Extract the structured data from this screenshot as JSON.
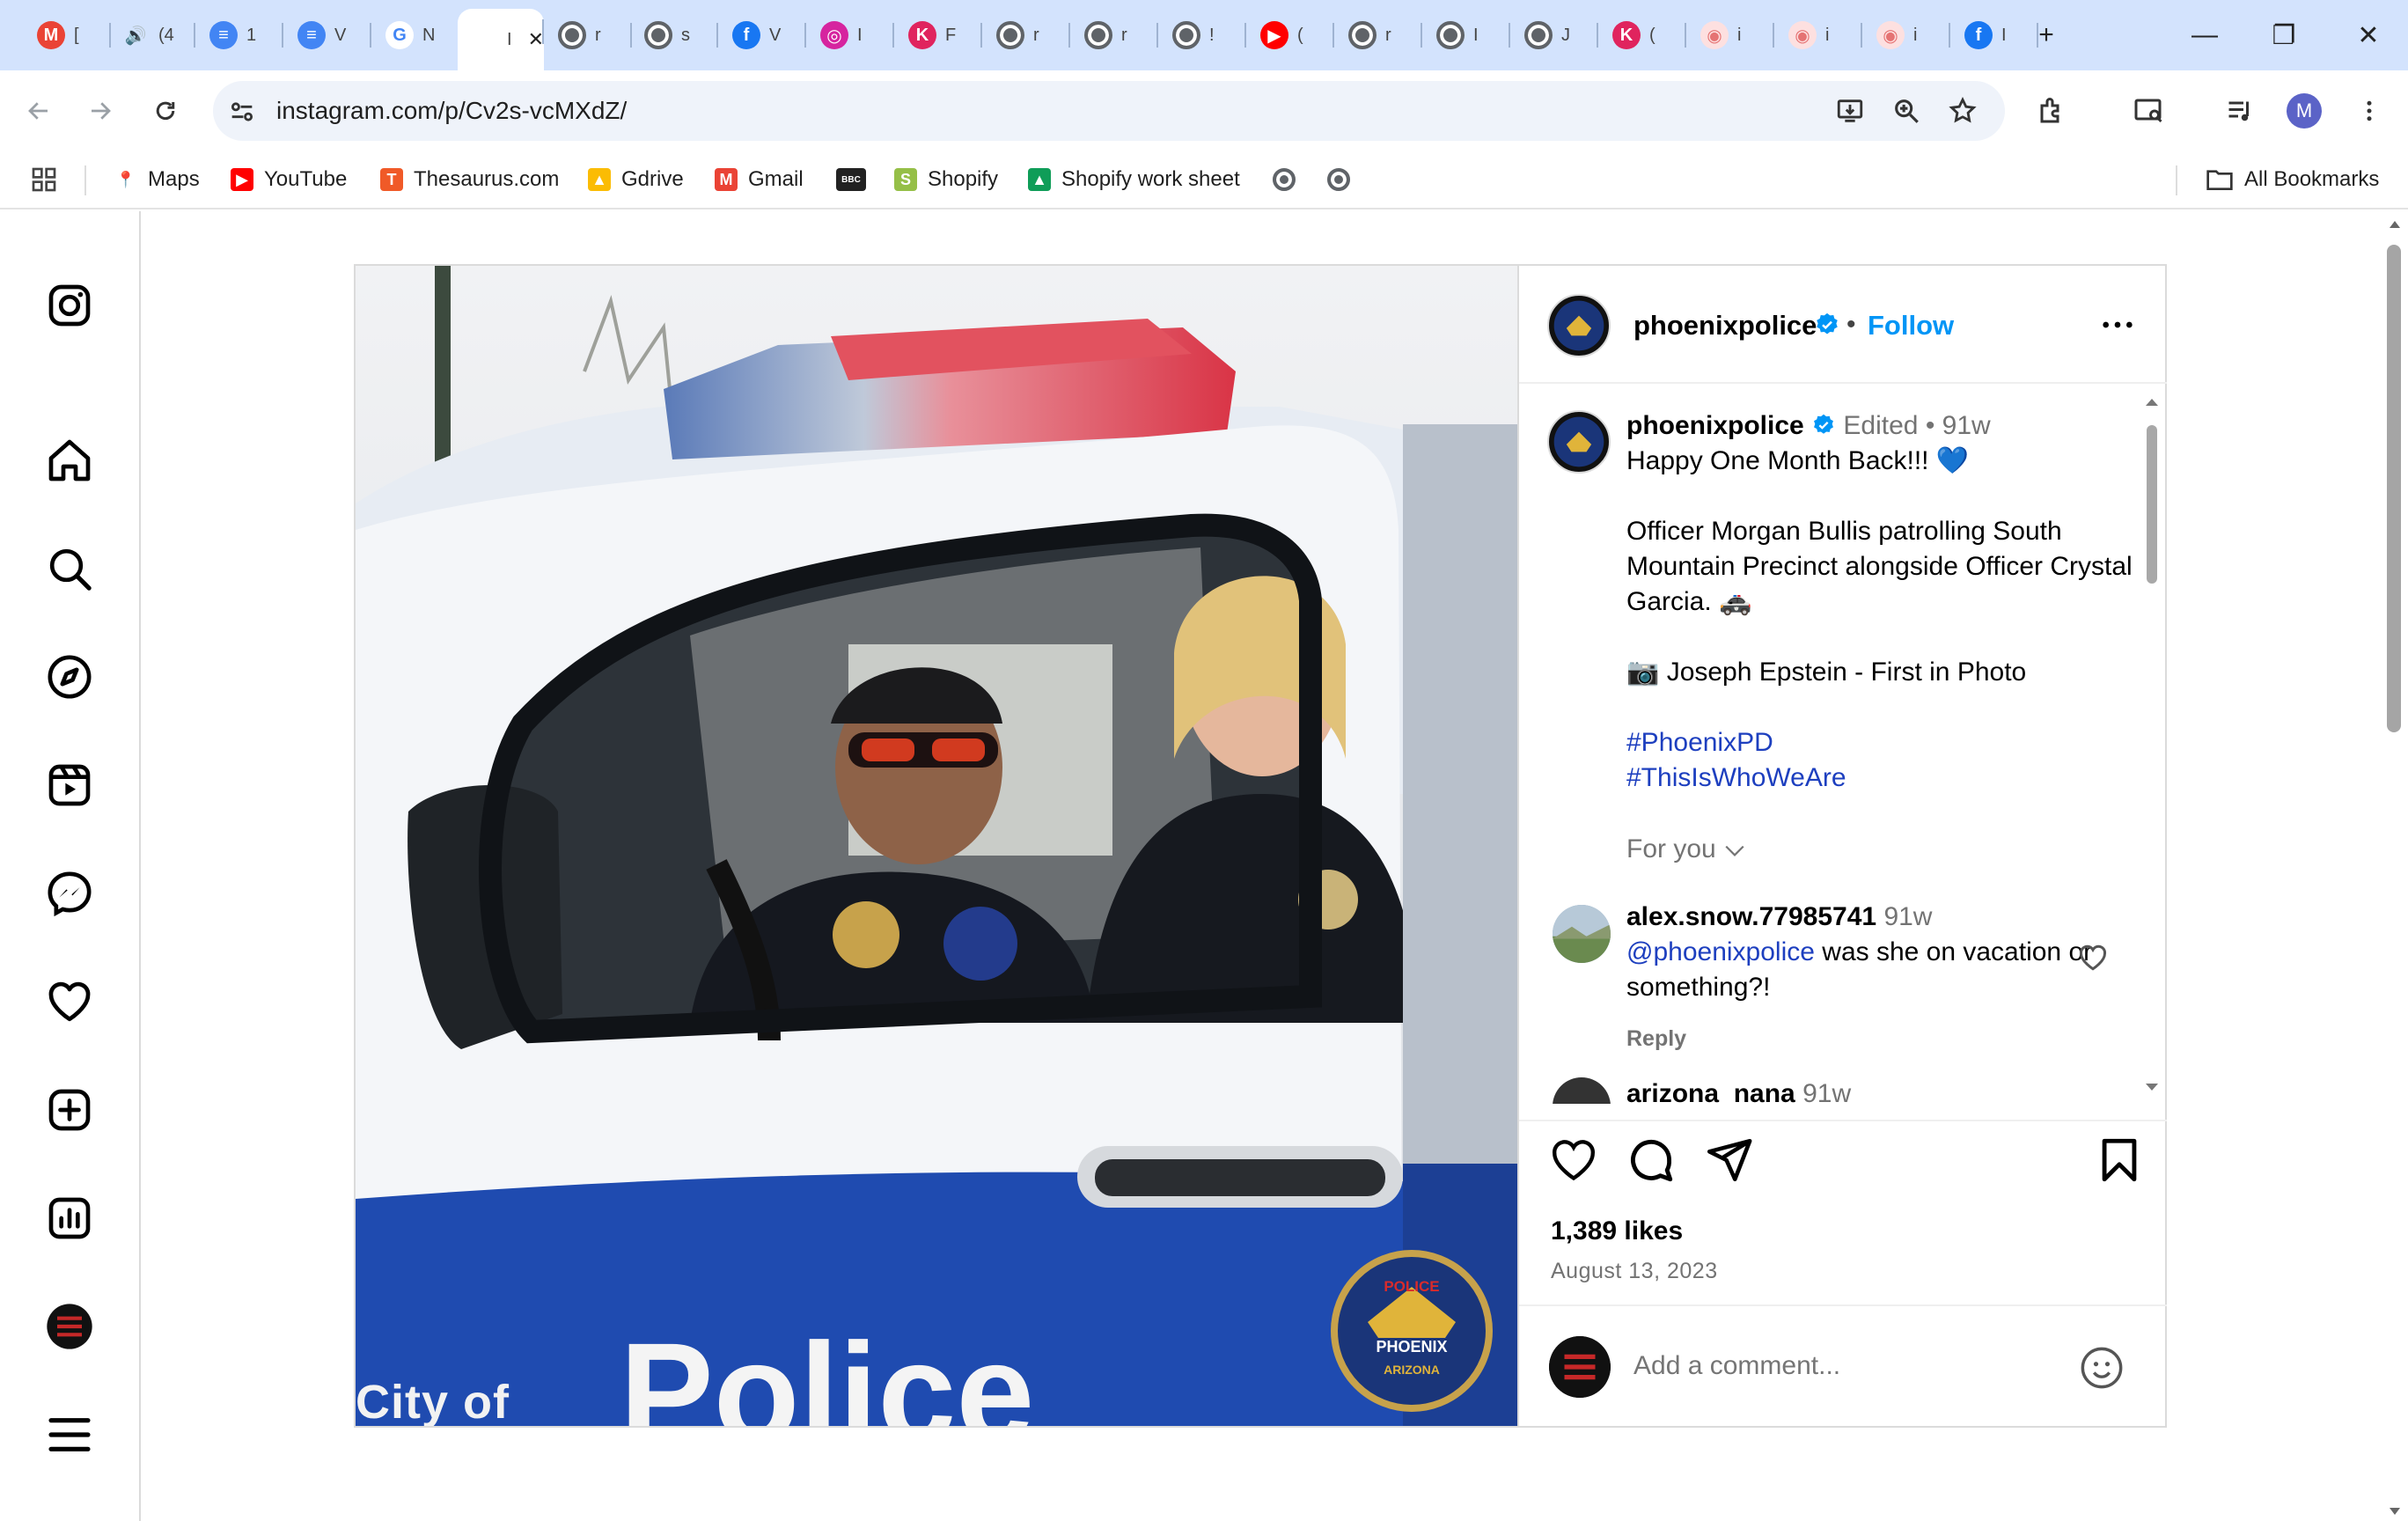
{
  "browser": {
    "tabs": [
      {
        "title": "[",
        "icon": "gmail-icon",
        "color": "#ea4335",
        "glyph": "M"
      },
      {
        "title": "(4",
        "icon": "speaker-icon",
        "color": "#5f6368",
        "glyph": "🔊"
      },
      {
        "title": "1",
        "icon": "docs-icon",
        "color": "#4285f4",
        "glyph": "≡"
      },
      {
        "title": "V",
        "icon": "docs-icon",
        "color": "#4285f4",
        "glyph": "≡"
      },
      {
        "title": "N",
        "icon": "google-icon",
        "color": "#ffffff",
        "glyph": "G"
      },
      {
        "title": "I",
        "icon": "instagram-icon",
        "color": "#ffffff",
        "glyph": ""
      },
      {
        "title": "r",
        "icon": "globe-icon",
        "color": "#5f6368",
        "glyph": ""
      },
      {
        "title": "s",
        "icon": "globe-icon",
        "color": "#5f6368",
        "glyph": ""
      },
      {
        "title": "V",
        "icon": "facebook-icon",
        "color": "#1877f2",
        "glyph": "f"
      },
      {
        "title": "I",
        "icon": "instagram-icon",
        "color": "#d6249f",
        "glyph": "◎"
      },
      {
        "title": "F",
        "icon": "k-icon",
        "color": "#e0245e",
        "glyph": "K"
      },
      {
        "title": "r",
        "icon": "globe-icon",
        "color": "#5f6368",
        "glyph": ""
      },
      {
        "title": "r",
        "icon": "globe-icon",
        "color": "#5f6368",
        "glyph": ""
      },
      {
        "title": "!",
        "icon": "globe-icon",
        "color": "#5f6368",
        "glyph": ""
      },
      {
        "title": "(",
        "icon": "youtube-icon",
        "color": "#ff0000",
        "glyph": "▶"
      },
      {
        "title": "r",
        "icon": "globe-icon",
        "color": "#5f6368",
        "glyph": ""
      },
      {
        "title": "I",
        "icon": "globe-icon",
        "color": "#5f6368",
        "glyph": ""
      },
      {
        "title": "J",
        "icon": "globe-icon",
        "color": "#5f6368",
        "glyph": ""
      },
      {
        "title": "(",
        "icon": "k-icon",
        "color": "#e0245e",
        "glyph": "K"
      },
      {
        "title": "i",
        "icon": "site-icon",
        "color": "#e57373",
        "glyph": "◉"
      },
      {
        "title": "i",
        "icon": "site-icon",
        "color": "#e57373",
        "glyph": "◉"
      },
      {
        "title": "i",
        "icon": "site-icon",
        "color": "#e57373",
        "glyph": "◉"
      },
      {
        "title": "I",
        "icon": "facebook-icon",
        "color": "#1877f2",
        "glyph": "f"
      }
    ],
    "new_tab": "+",
    "window": {
      "minimize": "—",
      "restore": "❐",
      "close": "✕"
    },
    "url": "instagram.com/p/Cv2s-vcMXdZ/",
    "profile_initial": "M",
    "bookmarks": [
      {
        "label": "Maps",
        "icon": "maps-icon",
        "color": "#34a853",
        "glyph": "📍"
      },
      {
        "label": "YouTube",
        "icon": "youtube-icon",
        "color": "#ff0000",
        "glyph": "▶"
      },
      {
        "label": "Thesaurus.com",
        "icon": "thesaurus-icon",
        "color": "#f05a28",
        "glyph": "T"
      },
      {
        "label": "Gdrive",
        "icon": "drive-icon",
        "color": "#fbbc04",
        "glyph": "▲"
      },
      {
        "label": "Gmail",
        "icon": "gmail-icon",
        "color": "#ea4335",
        "glyph": "M"
      },
      {
        "label": "",
        "icon": "bbc-icon",
        "color": "#222222",
        "glyph": "BBC"
      },
      {
        "label": "Shopify",
        "icon": "shopify-icon",
        "color": "#95bf47",
        "glyph": "S"
      },
      {
        "label": "Shopify work sheet",
        "icon": "drive-icon",
        "color": "#0f9d58",
        "glyph": "▲"
      },
      {
        "label": "",
        "icon": "globe-icon",
        "color": "#5f6368",
        "glyph": ""
      },
      {
        "label": "",
        "icon": "globe-icon",
        "color": "#5f6368",
        "glyph": ""
      }
    ],
    "all_bookmarks": "All Bookmarks"
  },
  "post": {
    "username": "phoenixpolice",
    "follow": "Follow",
    "dot": "•",
    "edited": "Edited",
    "age": "91w",
    "caption_line1": "Happy One Month Back!!! 💙",
    "caption_line2": "Officer Morgan Bullis patrolling South Mountain Precinct alongside Officer Crystal Garcia. 🚓",
    "caption_line3": "📷 Joseph Epstein - First in Photo",
    "hashtags": [
      "#PhoenixPD",
      "#ThisIsWhoWeAre"
    ],
    "for_you": "For you",
    "comments": [
      {
        "user": "alex.snow.77985741",
        "age": "91w",
        "mention": "@phoenixpolice",
        "text": " was she on vacation or something?!",
        "reply": "Reply"
      },
      {
        "user": "arizona_nana",
        "age": "91w"
      }
    ],
    "likes": "1,389 likes",
    "date": "August 13, 2023",
    "add_comment_placeholder": "Add a comment...",
    "photo_text": {
      "city": "City of",
      "police": "Police",
      "badge_top": "POLICE",
      "badge_mid": "PHOENIX",
      "badge_bot": "ARIZONA"
    }
  },
  "sidebar_icons": [
    "instagram-logo-icon",
    "home-icon",
    "search-icon",
    "explore-icon",
    "reels-icon",
    "messenger-icon",
    "heart-icon",
    "create-icon",
    "dashboard-icon",
    "profile-avatar",
    "menu-icon"
  ],
  "colors": {
    "accent": "#0095f6",
    "verified": "#0095f6",
    "tab_strip": "#d3e3fd",
    "hashtag": "#1d3fbf"
  }
}
